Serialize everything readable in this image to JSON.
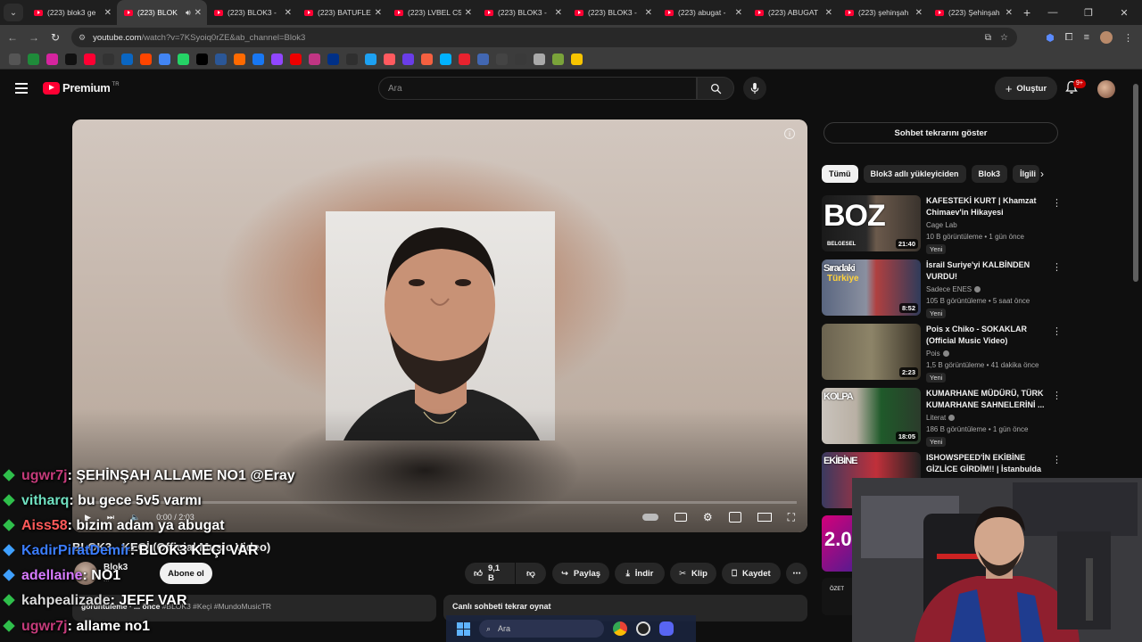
{
  "browser": {
    "tabs": [
      {
        "title": "(223) blok3 ge"
      },
      {
        "title": "(223) BLOK",
        "active": true
      },
      {
        "title": "(223) BLOK3 -"
      },
      {
        "title": "(223) BATUFLE"
      },
      {
        "title": "(223) LVBEL C5"
      },
      {
        "title": "(223) BLOK3 -"
      },
      {
        "title": "(223) BLOK3 -"
      },
      {
        "title": "(223) abugat -"
      },
      {
        "title": "(223) ABUGAT"
      },
      {
        "title": "(223) şehinşah"
      },
      {
        "title": "(223) Şehinşah"
      }
    ],
    "url_host": "youtube.com",
    "url_rest": "/watch?v=7KSyoiq0rZE&ab_channel=Blok3"
  },
  "youtube": {
    "logo_text": "Premium",
    "logo_region": "TR",
    "search_placeholder": "Ara",
    "create_label": "Oluştur",
    "notif_count": "9+"
  },
  "video": {
    "time": "0:00 / 2:03",
    "title": "BLOK3 - KEÇİ (Official Music Video)",
    "channel": "Blok3",
    "subscribers": "...",
    "subscribe_label": "Abone ol",
    "likes": "9,1 B",
    "share_label": "Paylaş",
    "download_label": "İndir",
    "clip_label": "Klip",
    "save_label": "Kaydet",
    "desc_meta": "görüntüleme · ... önce",
    "desc_tags": "#BLOK3 #Keçi #MundoMusicTR",
    "chat_replay_label": "Canlı sohbeti tekrar oynat"
  },
  "sidebar": {
    "show_chat_label": "Sohbet tekrarını göster",
    "chips": [
      "Tümü",
      "Blok3 adlı yükleyiciden",
      "Blok3",
      "İlgili"
    ],
    "recommendations": [
      {
        "title": "KAFESTEKİ KURT | Khamzat Chimaev'in Hikayesi",
        "channel": "Cage Lab",
        "meta": "10 B görüntüleme • 1 gün önce",
        "duration": "21:40",
        "badge": "Yeni",
        "verified": false,
        "thumb_text": "BOZ",
        "thumb_sub": "BELGESEL"
      },
      {
        "title": "İsrail Suriye'yi KALBİNDEN VURDU!",
        "channel": "Sadece ENES",
        "meta": "105 B görüntüleme • 5 saat önce",
        "duration": "8:52",
        "badge": "Yeni",
        "verified": true,
        "thumb_text": "Sıradaki",
        "thumb_sub": "Türkiye"
      },
      {
        "title": "Pois x Chiko - SOKAKLAR (Official Music Video)",
        "channel": "Pois",
        "meta": "1,5 B görüntüleme • 41 dakika önce",
        "duration": "2:23",
        "badge": "Yeni",
        "verified": true,
        "thumb_text": "",
        "thumb_sub": ""
      },
      {
        "title": "KUMARHANE MÜDÜRÜ, TÜRK KUMARHANE SAHNELERİNİ ...",
        "channel": "Literat",
        "meta": "186 B görüntüleme • 1 gün önce",
        "duration": "18:05",
        "badge": "Yeni",
        "verified": true,
        "thumb_text": "KOLPA",
        "thumb_sub": ""
      },
      {
        "title": "ISHOWSPEED'İN EKİBİNE GİZLİCE GİRDİM!! | İstanbulda ...",
        "channel": "",
        "meta": "",
        "duration": "",
        "badge": "",
        "verified": false,
        "thumb_text": "EKİBİNE",
        "thumb_sub": ""
      }
    ],
    "partial_thumbs": [
      "2.0",
      "ÖZET"
    ]
  },
  "chat_overlay": [
    {
      "user": "ugwr7j",
      "msg": ": ŞEHİNŞAH ALLAME NO1 @Eray",
      "color": "#c43b7a",
      "gem": "#2fbf4b"
    },
    {
      "user": "vitharq",
      "msg": ": bu gece 5v5 varmı",
      "color": "#6fe0c0",
      "gem": "#2fbf4b"
    },
    {
      "user": "Aiss58",
      "msg": ": bizim adam ya abugat",
      "color": "#ff5a5a",
      "gem": "#2fbf4b"
    },
    {
      "user": "KadirPiratDemir",
      "msg": ": BLOK3 KEÇİ VAR",
      "color": "#3b7dff",
      "gem": "#3fa0ff"
    },
    {
      "user": "adellaine",
      "msg": ": NO1",
      "color": "#d77bff",
      "gem": "#3fa0ff"
    },
    {
      "user": "kahpealizade",
      "msg": ": JEFF VAR",
      "color": "#d9d9d9",
      "gem": "#2fbf4b"
    },
    {
      "user": "ugwr7j",
      "msg": ": allame no1",
      "color": "#c43b7a",
      "gem": "#2fbf4b"
    }
  ],
  "taskbar": {
    "search_placeholder": "Ara"
  }
}
